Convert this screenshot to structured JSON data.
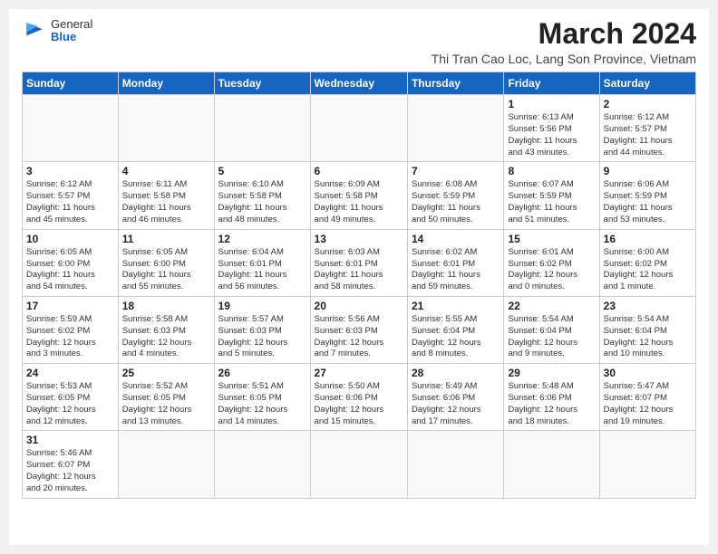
{
  "header": {
    "logo": {
      "general": "General",
      "blue": "Blue"
    },
    "month_title": "March 2024",
    "location": "Thi Tran Cao Loc, Lang Son Province, Vietnam"
  },
  "weekdays": [
    "Sunday",
    "Monday",
    "Tuesday",
    "Wednesday",
    "Thursday",
    "Friday",
    "Saturday"
  ],
  "weeks": [
    [
      {
        "day": "",
        "info": ""
      },
      {
        "day": "",
        "info": ""
      },
      {
        "day": "",
        "info": ""
      },
      {
        "day": "",
        "info": ""
      },
      {
        "day": "",
        "info": ""
      },
      {
        "day": "1",
        "info": "Sunrise: 6:13 AM\nSunset: 5:56 PM\nDaylight: 11 hours\nand 43 minutes."
      },
      {
        "day": "2",
        "info": "Sunrise: 6:12 AM\nSunset: 5:57 PM\nDaylight: 11 hours\nand 44 minutes."
      }
    ],
    [
      {
        "day": "3",
        "info": "Sunrise: 6:12 AM\nSunset: 5:57 PM\nDaylight: 11 hours\nand 45 minutes."
      },
      {
        "day": "4",
        "info": "Sunrise: 6:11 AM\nSunset: 5:58 PM\nDaylight: 11 hours\nand 46 minutes."
      },
      {
        "day": "5",
        "info": "Sunrise: 6:10 AM\nSunset: 5:58 PM\nDaylight: 11 hours\nand 48 minutes."
      },
      {
        "day": "6",
        "info": "Sunrise: 6:09 AM\nSunset: 5:58 PM\nDaylight: 11 hours\nand 49 minutes."
      },
      {
        "day": "7",
        "info": "Sunrise: 6:08 AM\nSunset: 5:59 PM\nDaylight: 11 hours\nand 50 minutes."
      },
      {
        "day": "8",
        "info": "Sunrise: 6:07 AM\nSunset: 5:59 PM\nDaylight: 11 hours\nand 51 minutes."
      },
      {
        "day": "9",
        "info": "Sunrise: 6:06 AM\nSunset: 5:59 PM\nDaylight: 11 hours\nand 53 minutes."
      }
    ],
    [
      {
        "day": "10",
        "info": "Sunrise: 6:05 AM\nSunset: 6:00 PM\nDaylight: 11 hours\nand 54 minutes."
      },
      {
        "day": "11",
        "info": "Sunrise: 6:05 AM\nSunset: 6:00 PM\nDaylight: 11 hours\nand 55 minutes."
      },
      {
        "day": "12",
        "info": "Sunrise: 6:04 AM\nSunset: 6:01 PM\nDaylight: 11 hours\nand 56 minutes."
      },
      {
        "day": "13",
        "info": "Sunrise: 6:03 AM\nSunset: 6:01 PM\nDaylight: 11 hours\nand 58 minutes."
      },
      {
        "day": "14",
        "info": "Sunrise: 6:02 AM\nSunset: 6:01 PM\nDaylight: 11 hours\nand 59 minutes."
      },
      {
        "day": "15",
        "info": "Sunrise: 6:01 AM\nSunset: 6:02 PM\nDaylight: 12 hours\nand 0 minutes."
      },
      {
        "day": "16",
        "info": "Sunrise: 6:00 AM\nSunset: 6:02 PM\nDaylight: 12 hours\nand 1 minute."
      }
    ],
    [
      {
        "day": "17",
        "info": "Sunrise: 5:59 AM\nSunset: 6:02 PM\nDaylight: 12 hours\nand 3 minutes."
      },
      {
        "day": "18",
        "info": "Sunrise: 5:58 AM\nSunset: 6:03 PM\nDaylight: 12 hours\nand 4 minutes."
      },
      {
        "day": "19",
        "info": "Sunrise: 5:57 AM\nSunset: 6:03 PM\nDaylight: 12 hours\nand 5 minutes."
      },
      {
        "day": "20",
        "info": "Sunrise: 5:56 AM\nSunset: 6:03 PM\nDaylight: 12 hours\nand 7 minutes."
      },
      {
        "day": "21",
        "info": "Sunrise: 5:55 AM\nSunset: 6:04 PM\nDaylight: 12 hours\nand 8 minutes."
      },
      {
        "day": "22",
        "info": "Sunrise: 5:54 AM\nSunset: 6:04 PM\nDaylight: 12 hours\nand 9 minutes."
      },
      {
        "day": "23",
        "info": "Sunrise: 5:54 AM\nSunset: 6:04 PM\nDaylight: 12 hours\nand 10 minutes."
      }
    ],
    [
      {
        "day": "24",
        "info": "Sunrise: 5:53 AM\nSunset: 6:05 PM\nDaylight: 12 hours\nand 12 minutes."
      },
      {
        "day": "25",
        "info": "Sunrise: 5:52 AM\nSunset: 6:05 PM\nDaylight: 12 hours\nand 13 minutes."
      },
      {
        "day": "26",
        "info": "Sunrise: 5:51 AM\nSunset: 6:05 PM\nDaylight: 12 hours\nand 14 minutes."
      },
      {
        "day": "27",
        "info": "Sunrise: 5:50 AM\nSunset: 6:06 PM\nDaylight: 12 hours\nand 15 minutes."
      },
      {
        "day": "28",
        "info": "Sunrise: 5:49 AM\nSunset: 6:06 PM\nDaylight: 12 hours\nand 17 minutes."
      },
      {
        "day": "29",
        "info": "Sunrise: 5:48 AM\nSunset: 6:06 PM\nDaylight: 12 hours\nand 18 minutes."
      },
      {
        "day": "30",
        "info": "Sunrise: 5:47 AM\nSunset: 6:07 PM\nDaylight: 12 hours\nand 19 minutes."
      }
    ],
    [
      {
        "day": "31",
        "info": "Sunrise: 5:46 AM\nSunset: 6:07 PM\nDaylight: 12 hours\nand 20 minutes."
      },
      {
        "day": "",
        "info": ""
      },
      {
        "day": "",
        "info": ""
      },
      {
        "day": "",
        "info": ""
      },
      {
        "day": "",
        "info": ""
      },
      {
        "day": "",
        "info": ""
      },
      {
        "day": "",
        "info": ""
      }
    ]
  ]
}
